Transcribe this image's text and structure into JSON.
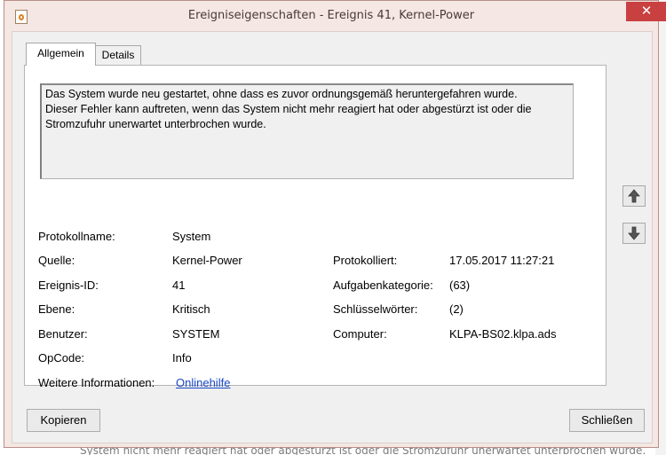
{
  "window": {
    "title": "Ereigniseigenschaften - Ereignis 41, Kernel-Power",
    "close_glyph": "✕",
    "app_icon": "event-viewer-icon"
  },
  "tabs": [
    {
      "label": "Allgemein",
      "selected": true
    },
    {
      "label": "Details",
      "selected": false
    }
  ],
  "description": "Das System wurde neu gestartet, ohne dass es zuvor ordnungsgemäß heruntergefahren wurde.\nDieser Fehler kann auftreten, wenn das System nicht mehr reagiert hat oder abgestürzt ist oder die\nStromzufuhr unerwartet unterbrochen wurde.",
  "fields": {
    "protokollname": {
      "label": "Protokollname:",
      "value": "System"
    },
    "quelle": {
      "label": "Quelle:",
      "value": "Kernel-Power"
    },
    "ereignis_id": {
      "label": "Ereignis-ID:",
      "value": "41"
    },
    "ebene": {
      "label": "Ebene:",
      "value": "Kritisch"
    },
    "benutzer": {
      "label": "Benutzer:",
      "value": "SYSTEM"
    },
    "opcode": {
      "label": "OpCode:",
      "value": "Info"
    },
    "weitere": {
      "label": "Weitere Informationen:",
      "link": "Onlinehilfe"
    },
    "protokolliert": {
      "label": "Protokolliert:",
      "value": "17.05.2017 11:27:21"
    },
    "aufgabenkategorie": {
      "label": "Aufgabenkategorie:",
      "value": "(63)"
    },
    "schluesselwoerter": {
      "label": "Schlüsselwörter:",
      "value": "(2)"
    },
    "computer": {
      "label": "Computer:",
      "value": "KLPA-BS02.klpa.ads"
    }
  },
  "nav": {
    "up_icon": "arrow-up-icon",
    "down_icon": "arrow-down-icon"
  },
  "buttons": {
    "copy": "Kopieren",
    "close": "Schließen"
  },
  "background": {
    "bottom_text": "System nicht mehr reagiert hat oder abgestürzt ist oder die Stromzufuhr unerwartet unterbrochen wurde."
  },
  "colors": {
    "titlebar": "#f4e7e4",
    "close_button": "#c94040",
    "link": "#1a47c8"
  }
}
